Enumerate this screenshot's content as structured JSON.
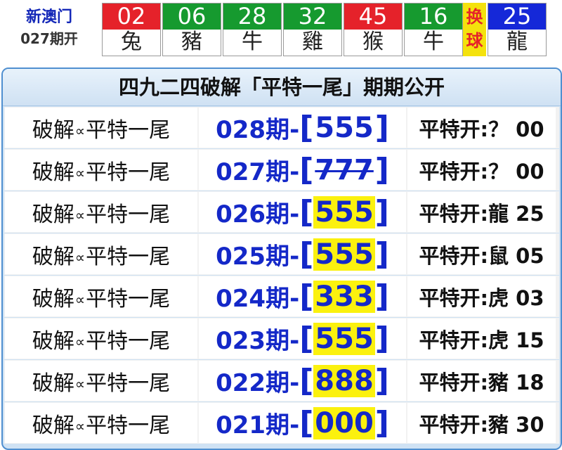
{
  "header": {
    "brand": "新澳门",
    "issue": "027期开",
    "balls": [
      {
        "num": "02",
        "zodiac": "兔",
        "color": "#e5222a"
      },
      {
        "num": "06",
        "zodiac": "豬",
        "color": "#169a2f"
      },
      {
        "num": "28",
        "zodiac": "牛",
        "color": "#169a2f"
      },
      {
        "num": "32",
        "zodiac": "雞",
        "color": "#169a2f"
      },
      {
        "num": "45",
        "zodiac": "猴",
        "color": "#e5222a"
      },
      {
        "num": "16",
        "zodiac": "牛",
        "color": "#169a2f"
      }
    ],
    "swap_label": [
      "换",
      "球"
    ],
    "special": {
      "num": "25",
      "zodiac": "龍",
      "color": "#1528d8"
    }
  },
  "panel": {
    "title": "四九二四破解「平特一尾」期期公开",
    "rows": [
      {
        "label_a": "破解",
        "label_sep": "∝",
        "label_b": "平特一尾",
        "issue": "028期-",
        "pick": "555",
        "status": "pending",
        "result": "平特开:？ 00"
      },
      {
        "label_a": "破解",
        "label_sep": "∝",
        "label_b": "平特一尾",
        "issue": "027期-",
        "pick": "777",
        "status": "miss",
        "result": "平特开:？ 00"
      },
      {
        "label_a": "破解",
        "label_sep": "∝",
        "label_b": "平特一尾",
        "issue": "026期-",
        "pick": "555",
        "status": "hit",
        "result": "平特开:龍 25"
      },
      {
        "label_a": "破解",
        "label_sep": "∝",
        "label_b": "平特一尾",
        "issue": "025期-",
        "pick": "555",
        "status": "hit",
        "result": "平特开:鼠 05"
      },
      {
        "label_a": "破解",
        "label_sep": "∝",
        "label_b": "平特一尾",
        "issue": "024期-",
        "pick": "333",
        "status": "hit",
        "result": "平特开:虎 03"
      },
      {
        "label_a": "破解",
        "label_sep": "∝",
        "label_b": "平特一尾",
        "issue": "023期-",
        "pick": "555",
        "status": "hit",
        "result": "平特开:虎 15"
      },
      {
        "label_a": "破解",
        "label_sep": "∝",
        "label_b": "平特一尾",
        "issue": "022期-",
        "pick": "888",
        "status": "hit",
        "result": "平特开:豬 18"
      },
      {
        "label_a": "破解",
        "label_sep": "∝",
        "label_b": "平特一尾",
        "issue": "021期-",
        "pick": "000",
        "status": "hit",
        "result": "平特开:豬 30"
      }
    ]
  },
  "colors": {
    "red_ball": "#e5222a",
    "green_ball": "#169a2f",
    "blue_ball": "#1528d8",
    "prediction_text": "#1428c8",
    "highlight": "#fbf10e",
    "panel_border": "#4f8fd0"
  }
}
